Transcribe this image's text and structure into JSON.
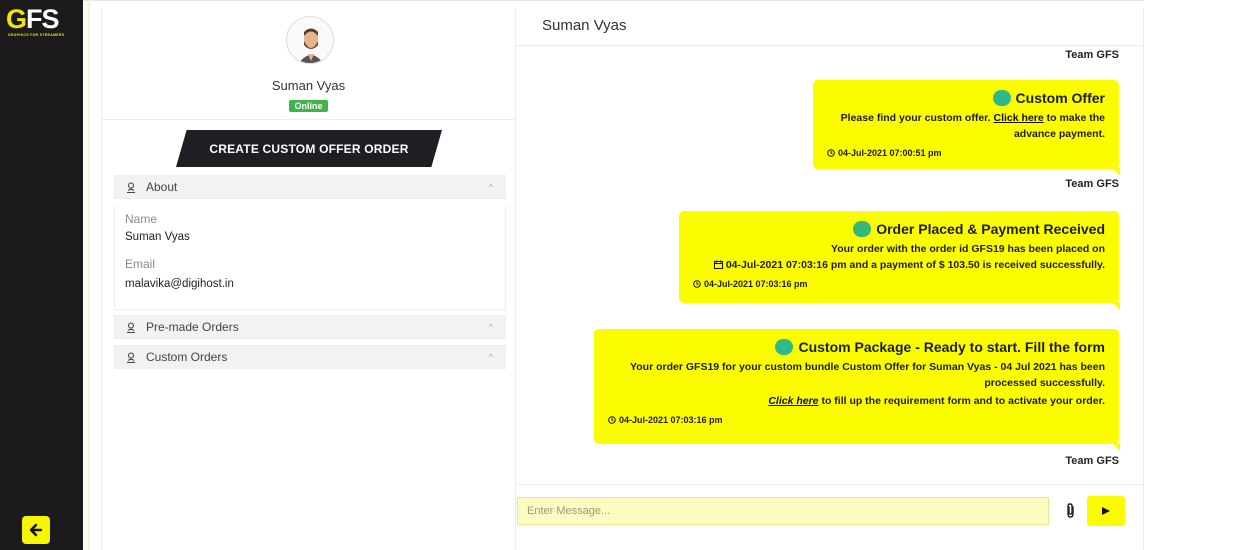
{
  "brand": {
    "logo_text": "GFS",
    "logo_sub": "GRAPHICS FOR STREAMERS",
    "accent": "#f7f500",
    "sidebar_bg": "#1c1a1d"
  },
  "sidebar": {
    "back_icon": "arrow-left-icon"
  },
  "profile": {
    "name": "Suman Vyas",
    "status": "Online",
    "create_button": "CREATE CUSTOM OFFER ORDER",
    "about": {
      "title": "About",
      "name_label": "Name",
      "name_value": "Suman Vyas",
      "email_label": "Email",
      "email_value": "malavika@digihost.in"
    },
    "premade_title": "Pre-made Orders",
    "custom_title": "Custom Orders"
  },
  "chat": {
    "title": "Suman Vyas",
    "team_label": "Team GFS",
    "messages": [
      {
        "title": "Custom Offer",
        "text_before": "Please find your custom offer. ",
        "link": "Click here",
        "text_after": " to make the",
        "text_line2": "advance payment.",
        "time": "04-Jul-2021 07:00:51 pm"
      },
      {
        "title": "Order Placed & Payment Received",
        "line1": "Your order with the order id GFS19 has been placed on",
        "line2": "04-Jul-2021 07:03:16 pm and a payment of $ 103.50 is received successfully.",
        "time": "04-Jul-2021 07:03:16 pm"
      },
      {
        "title": "Custom Package - Ready to start. Fill the form",
        "line1": "Your order GFS19 for your custom bundle Custom Offer for Suman Vyas - 04 Jul 2021 has been",
        "line2": "processed successfully.",
        "link": "Click here",
        "line3": " to fill up the requirement form and to activate your order.",
        "time": "04-Jul-2021 07:03:16 pm"
      }
    ],
    "input_placeholder": "Enter Message..."
  }
}
